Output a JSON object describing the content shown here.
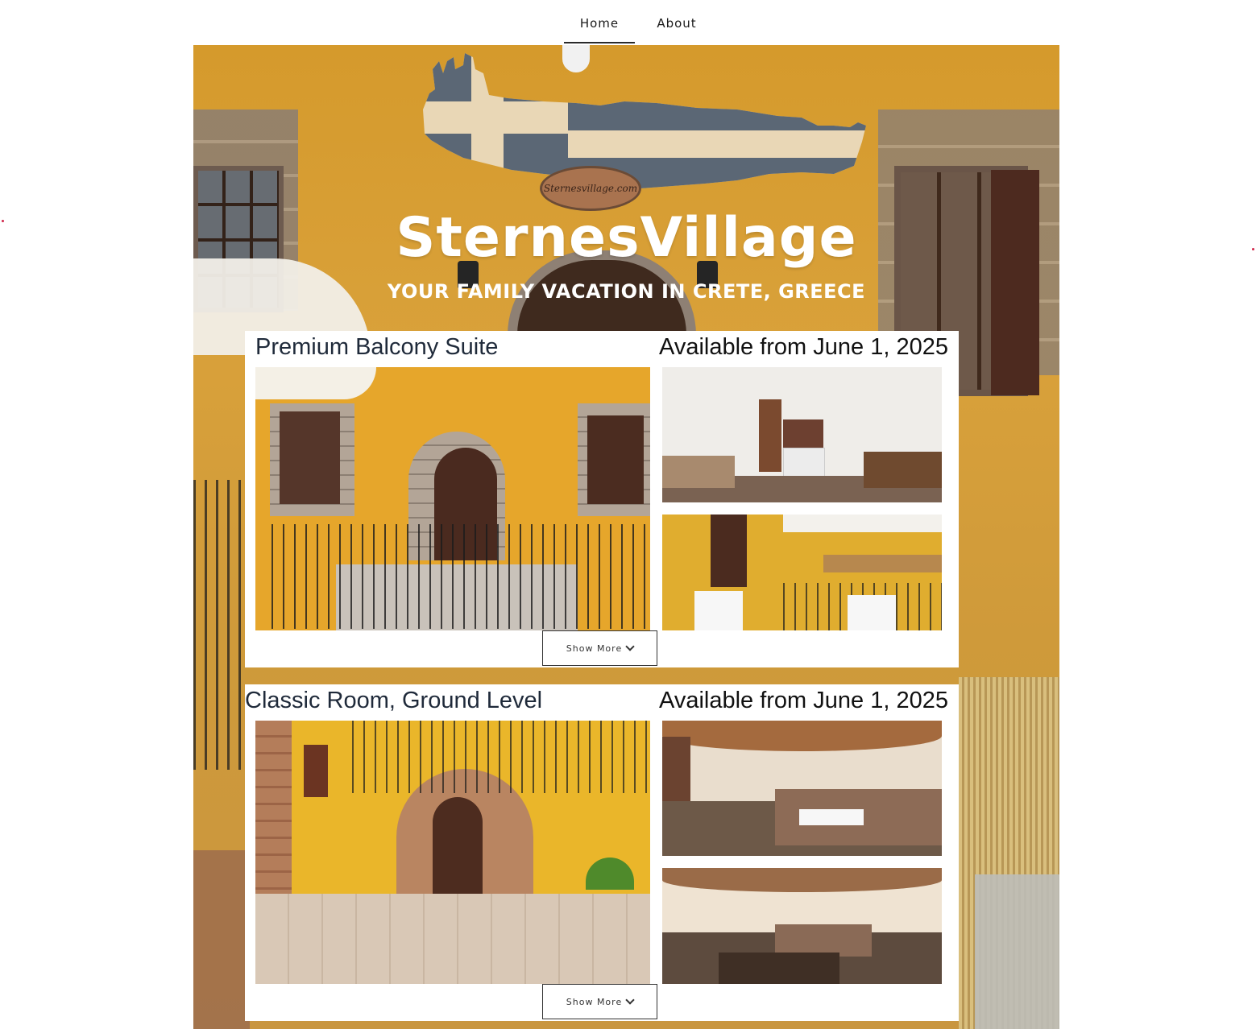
{
  "nav": {
    "items": [
      {
        "label": "Home",
        "active": true
      },
      {
        "label": "About",
        "active": false
      }
    ]
  },
  "hero": {
    "title": "SternesVillage",
    "tagline": "YOUR FAMILY VACATION IN CRETE, GREECE",
    "sign_text": "Sternesvillage.com"
  },
  "listings": [
    {
      "title": "Premium Balcony Suite",
      "availability": "Available from June 1, 2025",
      "show_more_label": "Show More",
      "photos": [
        "exterior-entrance",
        "living-kitchen",
        "balcony-terrace"
      ]
    },
    {
      "title": "Classic Room, Ground Level",
      "availability": "Available from June 1, 2025",
      "show_more_label": "Show More",
      "photos": [
        "exterior-arched-door",
        "bedroom-stone-ceiling",
        "room-dining-area"
      ]
    }
  ],
  "colors": {
    "accent_dot": "#d0264a",
    "wall_yellow": "#e6a62b",
    "title_text": "#1f2a3a"
  },
  "icons": {
    "show_more": "chevron-down-icon"
  }
}
